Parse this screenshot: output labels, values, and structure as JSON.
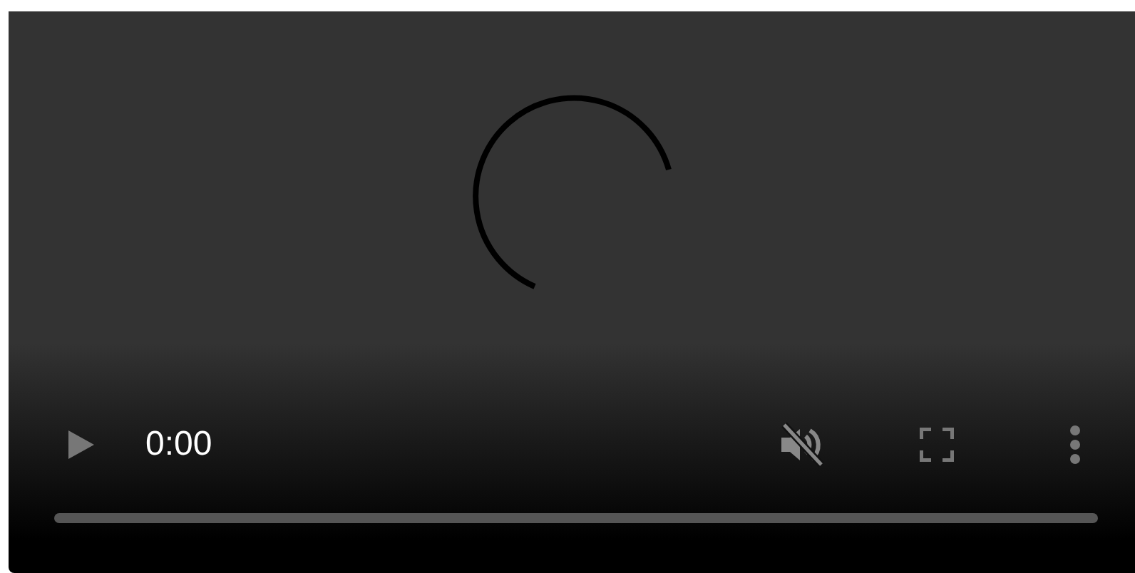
{
  "player": {
    "time": "0:00",
    "muted": true,
    "progress": {
      "level": 0
    }
  }
}
